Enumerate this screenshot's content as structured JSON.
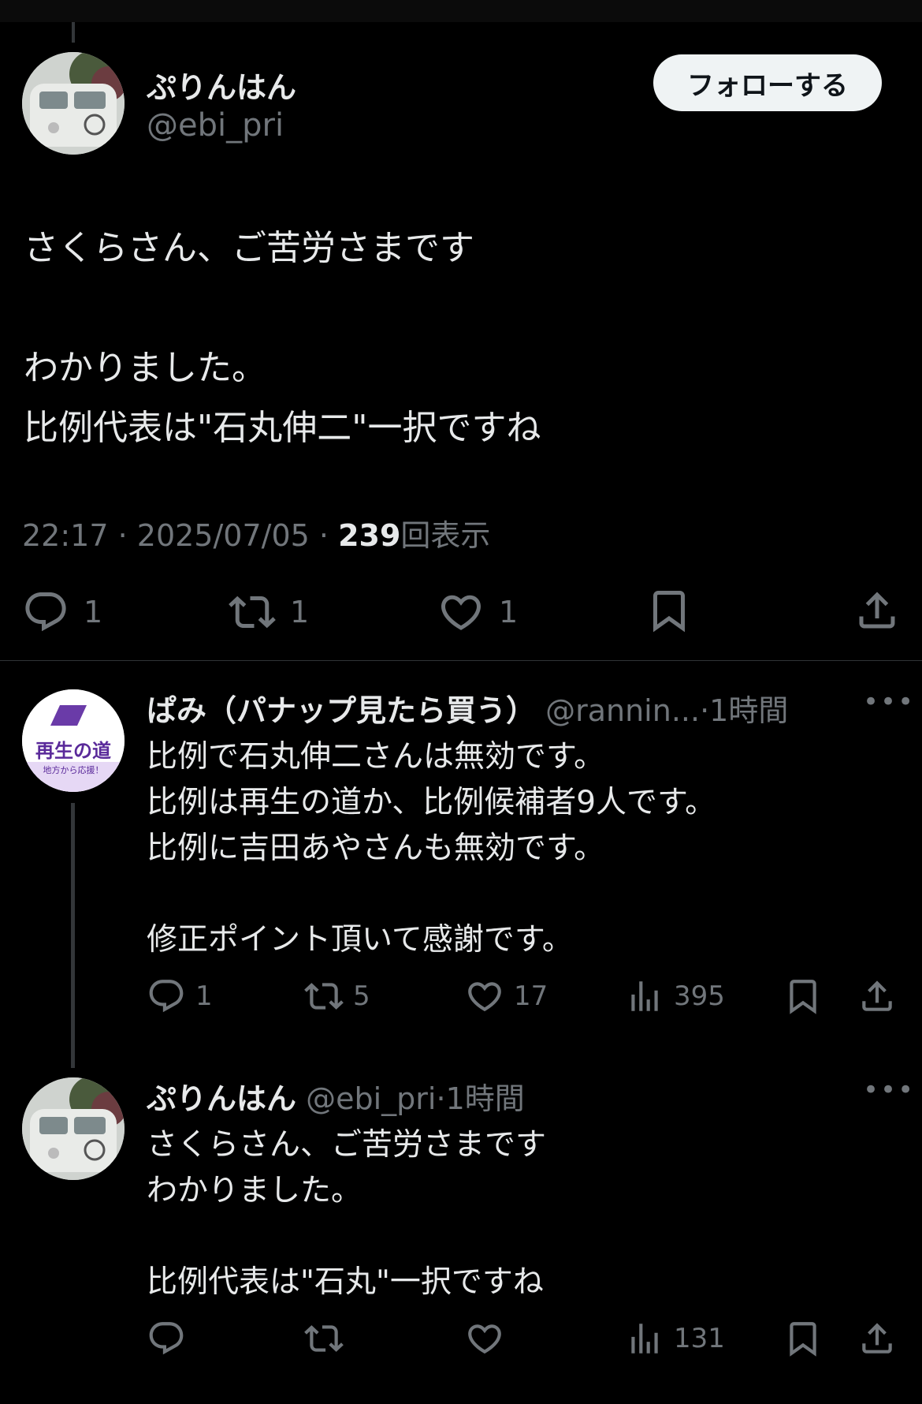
{
  "main_tweet": {
    "display_name": "ぷりんはん",
    "handle": "@ebi_pri",
    "follow_label": "フォローする",
    "text_lines": [
      "さくらさん、ご苦労さまです",
      "わかりました。",
      "比例代表は\"石丸伸二\"一択ですね"
    ],
    "time": "22:17",
    "date": "2025/07/05",
    "views": "239",
    "views_label": "回表示",
    "replies": "1",
    "retweets": "1",
    "likes": "1"
  },
  "replies": [
    {
      "display_name": "ぱみ（パナップ見たら買う）",
      "handle": "@rannin...",
      "time": "1時間",
      "avatar_text": "再生の道",
      "avatar_subtext": "地方から応援！",
      "text_lines": [
        "比例で石丸伸二さんは無効です。",
        "比例は再生の道か、比例候補者9人です。",
        "比例に吉田あやさんも無効です。",
        "修正ポイント頂いて感謝です。"
      ],
      "reply_count": "1",
      "retweet_count": "5",
      "like_count": "17",
      "view_count": "395"
    },
    {
      "display_name": "ぷりんはん",
      "handle": "@ebi_pri",
      "time": "1時間",
      "text_lines": [
        "さくらさん、ご苦労さまです",
        "わかりました。",
        "比例代表は\"石丸\"一択ですね"
      ],
      "view_count": "131"
    }
  ],
  "icons": {
    "reply": "reply-icon",
    "retweet": "retweet-icon",
    "like": "heart-icon",
    "bookmark": "bookmark-icon",
    "share": "share-icon",
    "views": "views-icon",
    "more": "more-icon"
  },
  "colors": {
    "background": "#000000",
    "text": "#e7e9ea",
    "muted": "#71767b",
    "follow_bg": "#eff3f4",
    "avatar_purple": "#5a2a9a"
  }
}
